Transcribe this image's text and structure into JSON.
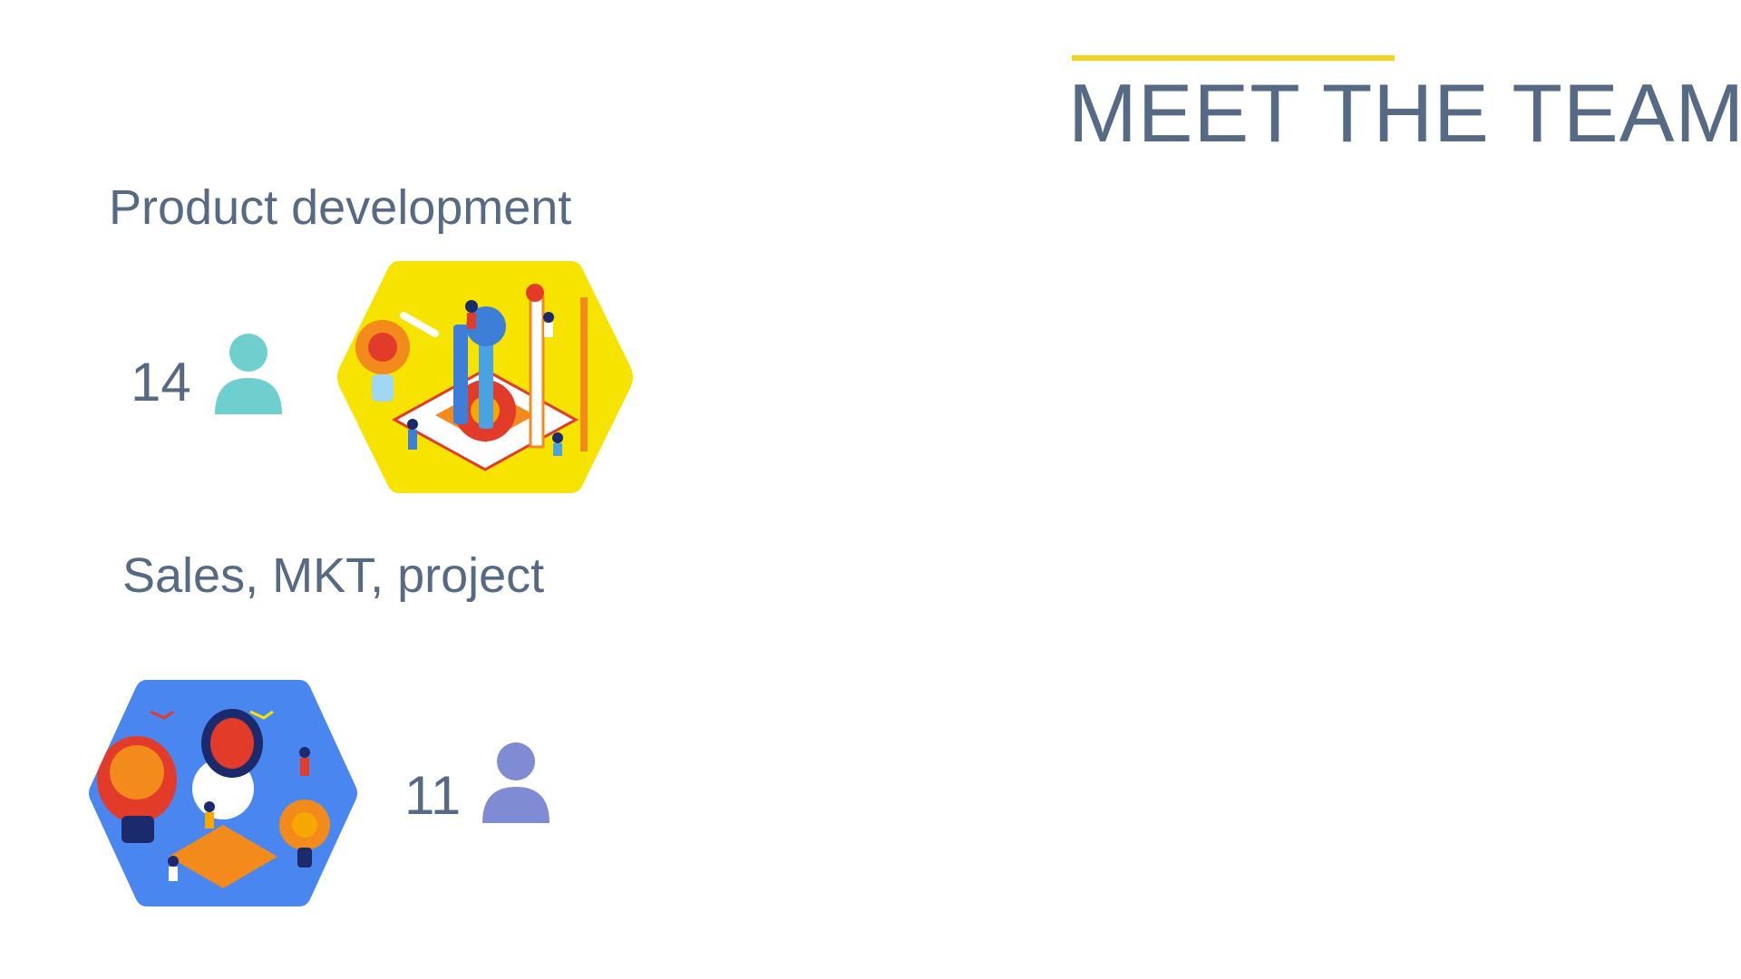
{
  "header": {
    "title": "MEET THE TEAM",
    "accent_color": "#f5d21c"
  },
  "teams": [
    {
      "name": "Product development",
      "member_count": "14",
      "icon": "person-icon",
      "icon_color": "#6ecfce",
      "illustration": "product-development-illustration",
      "illustration_bg": "#f7e300"
    },
    {
      "name": "Sales, MKT, project",
      "member_count": "11",
      "icon": "person-icon",
      "icon_color": "#7f8bd2",
      "illustration": "sales-marketing-illustration",
      "illustration_bg": "#4a86f0"
    }
  ],
  "text_color": "#566a86"
}
